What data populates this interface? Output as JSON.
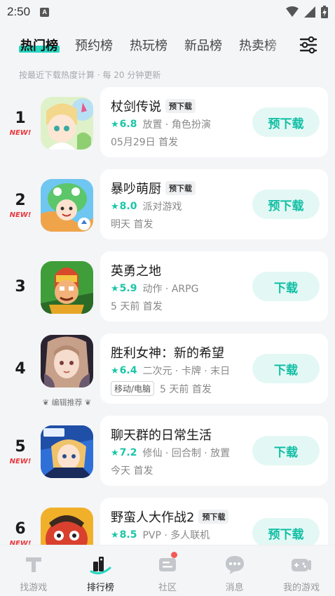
{
  "status_bar": {
    "time": "2:50",
    "app_glyph": "A"
  },
  "tabs": [
    {
      "label": "热门榜",
      "active": true
    },
    {
      "label": "预约榜"
    },
    {
      "label": "热玩榜"
    },
    {
      "label": "新品榜"
    },
    {
      "label": "热卖榜"
    }
  ],
  "note": "按最近下载热度计算 · 每 20 分钟更新",
  "list": [
    {
      "rank": "1",
      "new": "NEW!",
      "name": "杖剑传说",
      "badge": "预下载",
      "score": "6.8",
      "tags": "放置 · 角色扮演",
      "info": "05月29日 首发",
      "button": "预下载"
    },
    {
      "rank": "2",
      "new": "NEW!",
      "name": "暴吵萌厨",
      "badge": "预下载",
      "score": "8.0",
      "tags": "派对游戏",
      "info": "明天 首发",
      "button": "预下载"
    },
    {
      "rank": "3",
      "name": "英勇之地",
      "score": "5.9",
      "tags": "动作 · ARPG",
      "info": "5 天前 首发",
      "button": "下载"
    },
    {
      "rank": "4",
      "name": "胜利女神：新的希望",
      "score": "6.4",
      "tags": "二次元 · 卡牌 · 末日",
      "platform": "移动/电脑",
      "info": "5 天前 首发",
      "button": "下载",
      "editor": "编辑推荐"
    },
    {
      "rank": "5",
      "new": "NEW!",
      "name": "聊天群的日常生活",
      "score": "7.2",
      "tags": "修仙 · 回合制 · 放置",
      "info": "今天 首发",
      "button": "下载"
    },
    {
      "rank": "6",
      "new": "NEW!",
      "name": "野蛮人大作战2",
      "badge": "预下载",
      "score": "8.5",
      "tags": "PVP · 多人联机",
      "info": "",
      "button": "预下载"
    }
  ],
  "bottom_nav": [
    {
      "label": "找游戏",
      "icon": "find-game-icon"
    },
    {
      "label": "排行榜",
      "icon": "ranking-icon",
      "active": true
    },
    {
      "label": "社区",
      "icon": "community-icon",
      "dot": true
    },
    {
      "label": "消息",
      "icon": "message-icon"
    },
    {
      "label": "我的游戏",
      "icon": "my-games-icon"
    }
  ],
  "colors": {
    "accent": "#19c6a8",
    "accent_bg": "#e3f8f4",
    "new_red": "#e8383d",
    "tab_highlight": "#27d7c1"
  }
}
